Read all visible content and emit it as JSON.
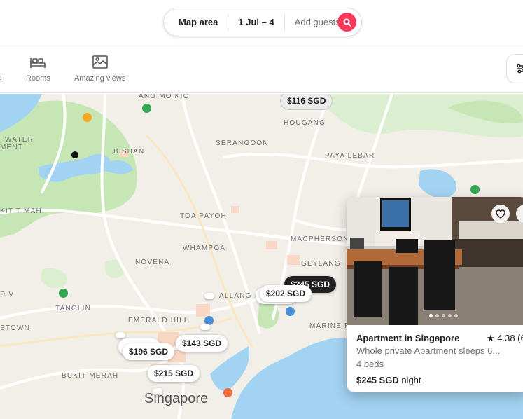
{
  "search": {
    "location": "Map area",
    "dates": "1 Jul – 4",
    "guests": "Add guests"
  },
  "categories": {
    "cut_label": "s",
    "items": [
      {
        "label": "Rooms",
        "icon": "bed-icon"
      },
      {
        "label": "Amazing views",
        "icon": "views-icon"
      }
    ]
  },
  "map": {
    "labels": {
      "ang_mo_kio": "ANG MO KIO",
      "water": "WATER",
      "ment": "MENT",
      "hougang": "HOUGANG",
      "bishan": "BISHAN",
      "serangoon": "SERANGOON",
      "paya_lebar": "PAYA LEBAR",
      "kit_timah": "KIT TIMAH",
      "toa_payoh": "TOA PAYOH",
      "macpherson": "MACPHERSON",
      "whampoa": "WHAMPOA",
      "novena": "NOVENA",
      "geylang": "GEYLANG",
      "d_v": "D V",
      "tanglin": "TANGLIN",
      "allang": "ALLANG",
      "emerald_hill": "EMERALD HILL",
      "stown": "STOWN",
      "marine_pa": "MARINE PA",
      "bukit_merah": "BUKIT MERAH",
      "city": "Singapore"
    },
    "pins": {
      "p116": "$116 SGD",
      "p245": "$245 SGD",
      "p202": "$202 SGD",
      "p143": "$143 SGD",
      "p196": "$196 SGD",
      "p215": "$215 SGD"
    }
  },
  "card": {
    "title": "Apartment in Singapore",
    "rating": "★ 4.38 (6",
    "subtitle": "Whole private Apartment sleeps 6...",
    "beds": "4 beds",
    "price": "$245 SGD",
    "price_unit": "night"
  },
  "colors": {
    "brand": "#ff385c",
    "map_land": "#f2efe9",
    "map_green": "#c6e7b5",
    "map_water": "#a3d3f2"
  }
}
